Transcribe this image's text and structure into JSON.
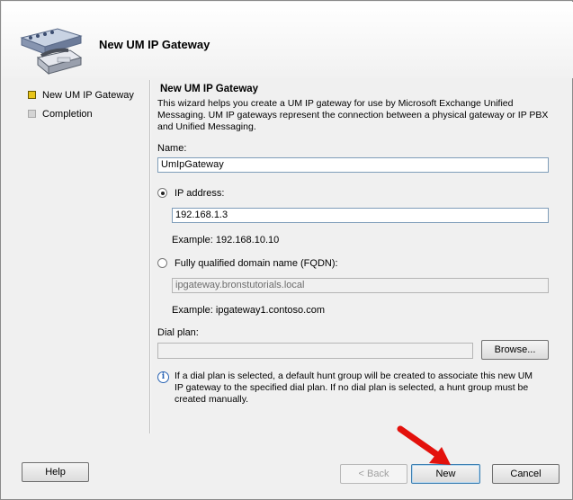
{
  "header": {
    "title": "New UM IP Gateway"
  },
  "steps": [
    {
      "label": "New UM IP Gateway",
      "state": "active"
    },
    {
      "label": "Completion",
      "state": "inactive"
    }
  ],
  "content": {
    "title": "New UM IP Gateway",
    "description": "This wizard helps you create a UM IP gateway for use by Microsoft Exchange Unified Messaging. UM IP gateways represent the connection between a physical gateway or IP PBX and Unified Messaging.",
    "name_label": "Name:",
    "name_value": "UmIpGateway",
    "ip_label": "IP address:",
    "ip_value": "192.168.1.3",
    "ip_example": "Example: 192.168.10.10",
    "fqdn_label": "Fully qualified domain name (FQDN):",
    "fqdn_value": "ipgateway.bronstutorials.local",
    "fqdn_example": "Example: ipgateway1.contoso.com",
    "dialplan_label": "Dial plan:",
    "dialplan_value": "",
    "browse_label": "Browse...",
    "info_text": "If a dial plan is selected, a default hunt group will be created to associate this new UM IP gateway to the specified dial plan. If no dial plan is selected, a hunt group must be created manually."
  },
  "buttons": {
    "help": "Help",
    "back": "< Back",
    "new": "New",
    "cancel": "Cancel"
  },
  "colors": {
    "arrow": "#e3110c",
    "active_step": "#e8c418"
  }
}
